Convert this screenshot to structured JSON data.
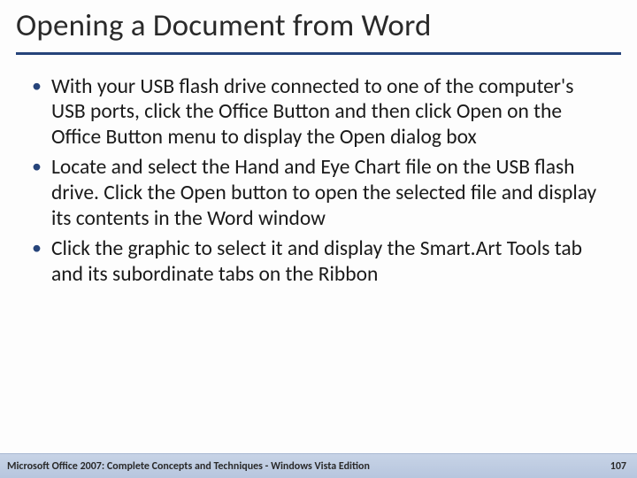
{
  "title": "Opening a Document from Word",
  "bullets": [
    "With your USB flash drive connected to one of the computer's USB ports, click the Office Button and then click Open on the Office Button menu to display the Open dialog box",
    "Locate and select the Hand and Eye Chart file on the USB flash drive. Click the Open button to open the selected file and display its contents in the Word window",
    "Click the graphic to select it and display the Smart.Art Tools tab and its subordinate tabs on the Ribbon"
  ],
  "footer": {
    "text": "Microsoft Office 2007: Complete Concepts and Techniques - Windows Vista Edition",
    "page": "107"
  }
}
